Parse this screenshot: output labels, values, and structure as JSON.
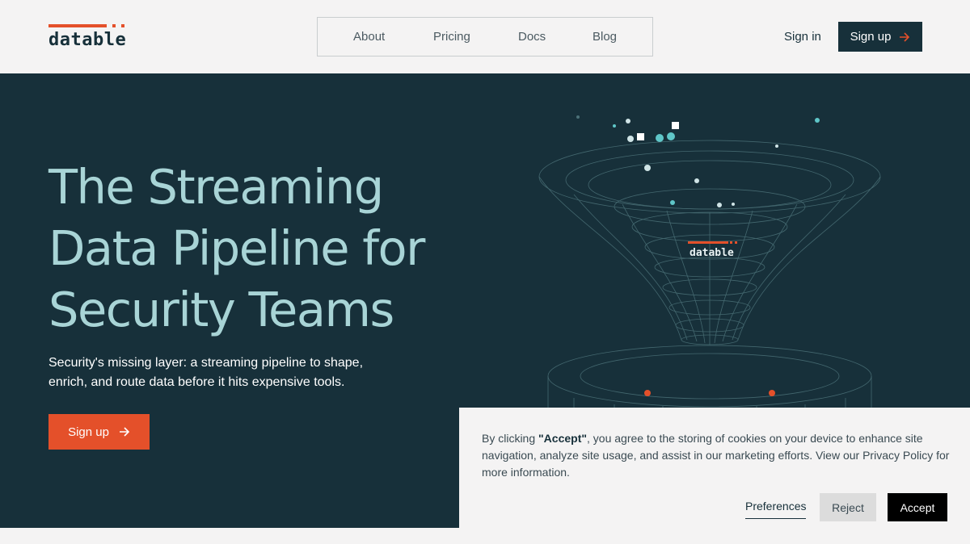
{
  "brand": {
    "name": "datable",
    "accent": "#e4502a",
    "dark": "#17303a",
    "headline_color": "#a8d4d6"
  },
  "nav": {
    "items": [
      {
        "label": "About"
      },
      {
        "label": "Pricing"
      },
      {
        "label": "Docs"
      },
      {
        "label": "Blog"
      }
    ],
    "sign_in": "Sign in",
    "sign_up": "Sign up",
    "arrow_icon": "arrow-right-icon"
  },
  "hero": {
    "headline_lines": [
      "The Streaming",
      "Data Pipeline for",
      "Security Teams"
    ],
    "subtext": "Security's missing layer: a streaming pipeline to shape, enrich, and route data before it hits expensive tools.",
    "cta_label": "Sign up",
    "funnel_label": "datable"
  },
  "cookie": {
    "text_prefix": "By clicking ",
    "text_bold": "\"Accept\"",
    "text_suffix": ", you agree to the storing of cookies on your device to enhance site navigation, analyze site usage, and assist in our marketing efforts. View our Privacy Policy for more information.",
    "preferences": "Preferences",
    "reject": "Reject",
    "accept": "Accept"
  }
}
